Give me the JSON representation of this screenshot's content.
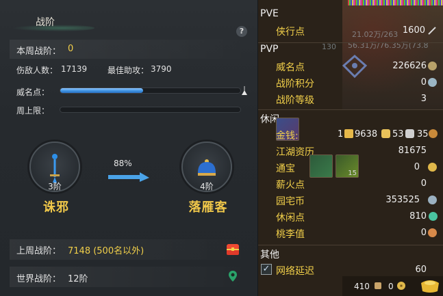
{
  "left": {
    "title": "战阶",
    "help": "?",
    "week_rank_label": "本周战阶：",
    "week_rank_value": "0",
    "kills_label": "伤敌人数：",
    "kills_value": "17139",
    "assist_label": "最佳助攻：",
    "assist_value": "3790",
    "fame_label": "威名点：",
    "fame_fill": 0.46,
    "week_cap_label": "周上限：",
    "week_cap_fill": 0.0,
    "current_rank": {
      "level": "3阶",
      "name": "诛邪"
    },
    "next_rank": {
      "level": "4阶",
      "name": "落雁客"
    },
    "progress_pct": "88%",
    "last_week_label": "上周战阶：",
    "last_week_value": "7148 (500名以外)",
    "world_rank_label": "世界战阶：",
    "world_rank_value": "12阶"
  },
  "right": {
    "pve_title": "PVE",
    "pve": [
      {
        "label": "侠行点",
        "value": "1600"
      }
    ],
    "pvp_title": "PVP",
    "pvp": [
      {
        "label": "威名点",
        "value": "226626"
      },
      {
        "label": "战阶积分",
        "value": "0"
      },
      {
        "label": "战阶等级",
        "value": "3"
      }
    ],
    "leisure_title": "休闲",
    "money_label": "金钱:",
    "money_gold_prefix": "1",
    "money_gold": "9638",
    "money_silver": "53",
    "money_copper": "35",
    "leisure": [
      {
        "label": "江湖资历",
        "value": "81675"
      },
      {
        "label": "通宝",
        "value": "0"
      },
      {
        "label": "薪火点",
        "value": "0"
      },
      {
        "label": "园宅币",
        "value": "353525"
      },
      {
        "label": "休闲点",
        "value": "810"
      },
      {
        "label": "桃李值",
        "value": "0"
      }
    ],
    "other_title": "其他",
    "latency_label": "网络延迟",
    "latency_value": "60",
    "thumb_count": "15",
    "footer_count1": "410",
    "footer_count2": "0"
  },
  "bg_overlay": {
    "line1": "21.02万/263",
    "line2": "56.31万/76.35万(73.8",
    "line3": "130"
  },
  "colors": {
    "accent_yellow": "#f2d04a",
    "bar_blue": "#3a8fe0",
    "rank_name": "#f0c84a"
  }
}
